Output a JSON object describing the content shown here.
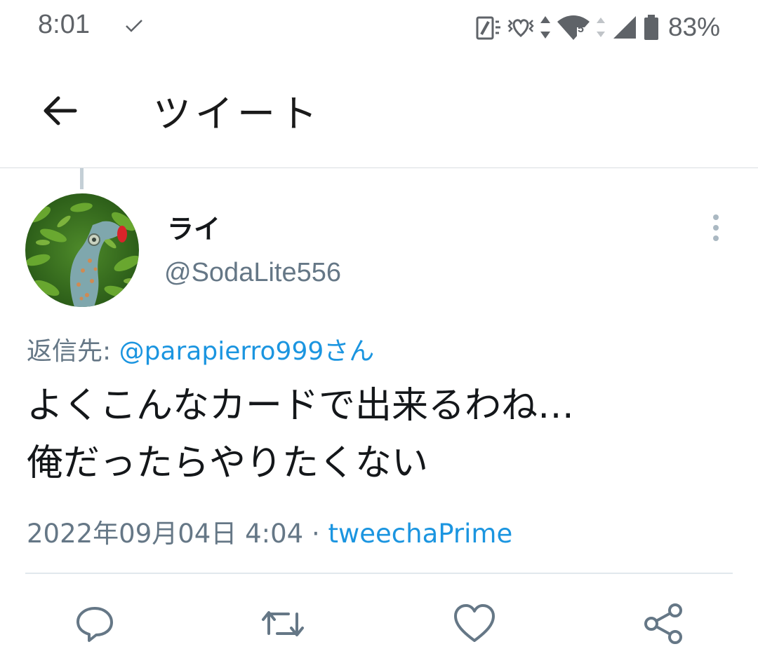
{
  "status_bar": {
    "time": "8:01",
    "battery": "83%",
    "icons": [
      "check-icon",
      "nfc-icon",
      "vibrate-icon",
      "data-arrows-icon",
      "wifi-icon",
      "cell-signal-icon",
      "battery-icon"
    ],
    "wifi_badge": "5"
  },
  "header": {
    "title": "ツイート",
    "back_icon": "arrow-left-icon"
  },
  "tweet": {
    "display_name": "ライ",
    "handle": "@SodaLite556",
    "reply_prefix": "返信先: ",
    "reply_to": "@parapierro999さん",
    "text_lines": [
      "よくこんなカードで出来るわね…",
      "俺だったらやりたくない"
    ],
    "timestamp": "2022年09月04日 4:04",
    "separator": " · ",
    "source": "tweechaPrime"
  },
  "actions": {
    "icons": [
      "reply-icon",
      "retweet-icon",
      "like-icon",
      "share-icon"
    ]
  },
  "colors": {
    "link": "#1b95e0",
    "secondary_text": "#657786",
    "primary_text": "#14171a",
    "divider": "#e1e8ed"
  }
}
